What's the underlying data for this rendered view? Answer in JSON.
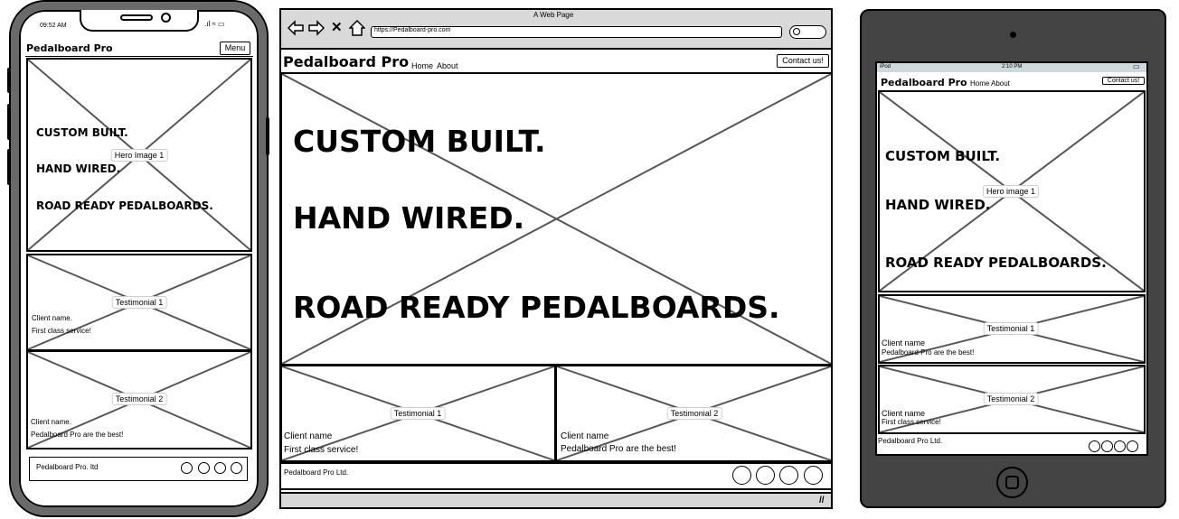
{
  "phone": {
    "time": "09:52 AM",
    "brand": "Pedalboard Pro",
    "menu_label": "Menu",
    "hero_label": "Hero Image 1",
    "hero_lines": [
      "CUSTOM BUILT.",
      "HAND WIRED.",
      "ROAD READY PEDALBOARDS."
    ],
    "testimonials": [
      {
        "label": "Testimonial 1",
        "client": "Client name.",
        "quote": "First class service!"
      },
      {
        "label": "Testimonial 2",
        "client": "Client name.",
        "quote": "Pedalboard Pro are the best!"
      }
    ],
    "footer": "Pedalboard Pro. ltd"
  },
  "browser": {
    "window_title": "A Web Page",
    "url": "https://Pedalboard-pro.com",
    "brand": "Pedalboard Pro",
    "nav": [
      "Home",
      "About"
    ],
    "contact_label": "Contact us!",
    "hero_lines": [
      "CUSTOM BUILT.",
      "HAND WIRED.",
      "ROAD READY PEDALBOARDS."
    ],
    "testimonials": [
      {
        "label": "Testimonial 1",
        "client": "Client name",
        "quote": "First class service!"
      },
      {
        "label": "Testimonial 2",
        "client": "Client name",
        "quote": "Pedalboard Pro are the best!"
      }
    ],
    "footer": "Pedalboard Pro Ltd."
  },
  "tablet": {
    "carrier": "iPod",
    "time": "2:10 PM",
    "brand": "Pedalboard Pro",
    "nav": [
      "Home",
      "About"
    ],
    "contact_label": "Contact us!",
    "hero_label": "Hero image 1",
    "hero_lines": [
      "CUSTOM BUILT.",
      "HAND WIRED.",
      "ROAD READY PEDALBOARDS."
    ],
    "testimonials": [
      {
        "label": "Testimonial 1",
        "client": "Client name",
        "quote": "Pedalboard Pro are the best!"
      },
      {
        "label": "Testimonial 2",
        "client": "Client name",
        "quote": "First class service!"
      }
    ],
    "footer": "Pedalboard Pro Ltd."
  }
}
